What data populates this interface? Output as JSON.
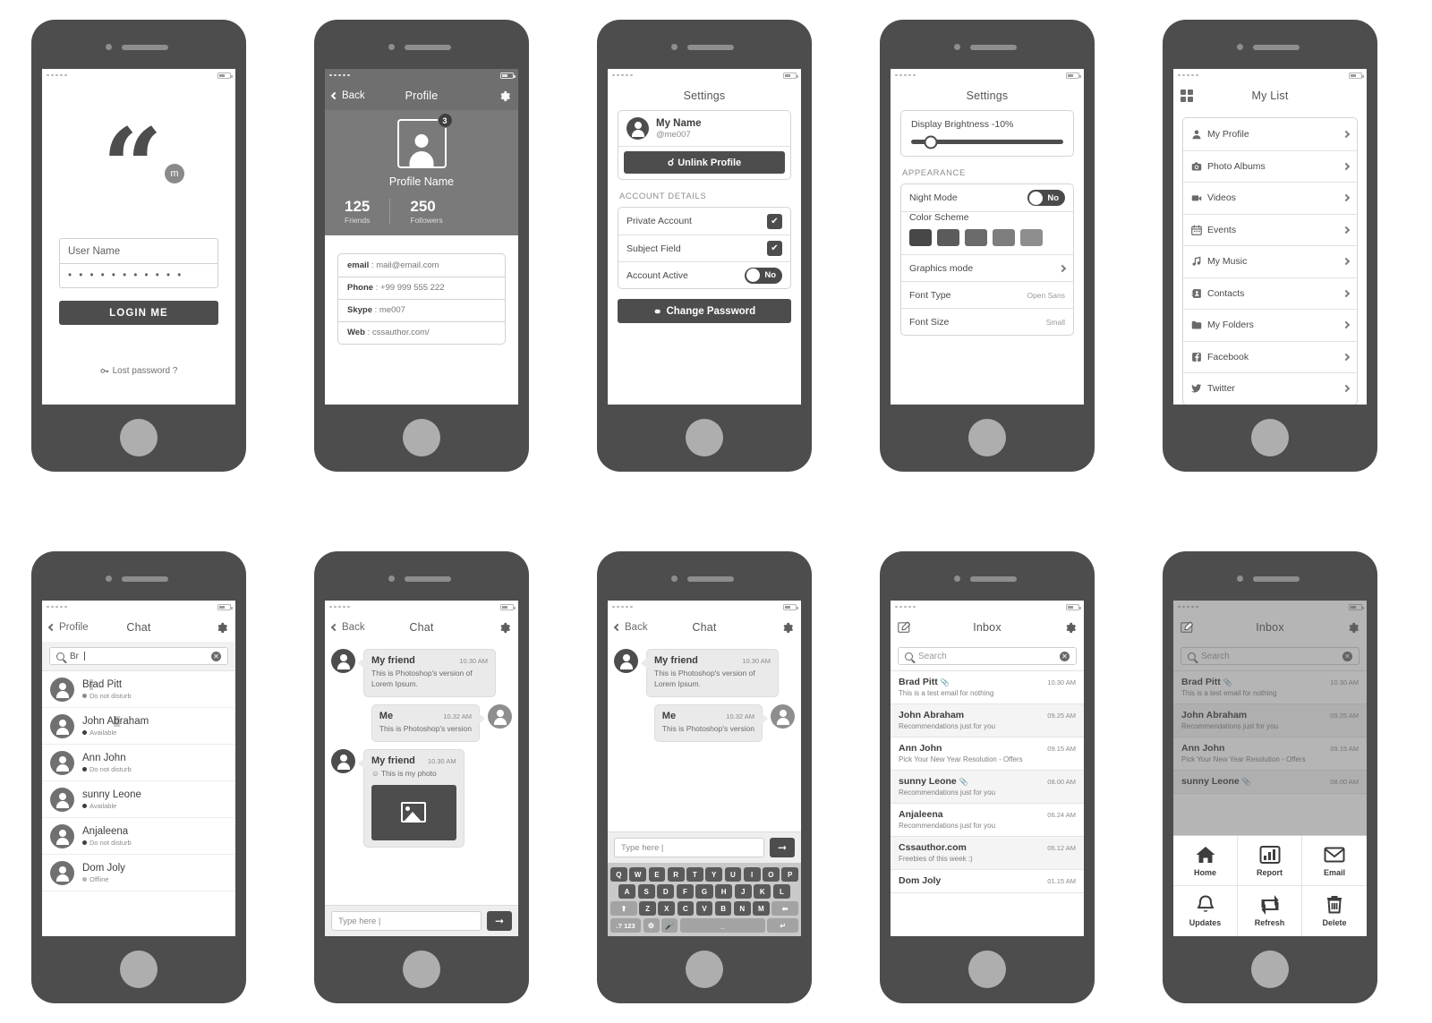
{
  "phone1": {
    "name": "login-screen",
    "logo_badge": "m",
    "username_value": "User Name",
    "password_value": "• • • • • • • • • • •",
    "login_button": "LOGIN ME",
    "lost_password": "Lost password ?"
  },
  "phone2": {
    "name": "profile-screen",
    "nav": {
      "back": "Back",
      "title": "Profile",
      "gear": "gear-icon"
    },
    "avatar_badge": "3",
    "profile_name": "Profile Name",
    "stats": [
      {
        "num": "125",
        "label": "Friends"
      },
      {
        "num": "250",
        "label": "Followers"
      }
    ],
    "info": [
      {
        "key": "email",
        "value": "mail@email.com"
      },
      {
        "key": "Phone",
        "value": "+99 999 555 222"
      },
      {
        "key": "Skype",
        "value": "me007"
      },
      {
        "key": "Web",
        "value": "cssauthor.com/"
      }
    ]
  },
  "phone3": {
    "name": "settings-account-screen",
    "nav_title": "Settings",
    "account": {
      "name": "My Name",
      "handle": "@me007"
    },
    "unlink_button": "Unlink Profile",
    "section_label": "ACCOUNT DETAILS",
    "rows": [
      {
        "label": "Private Account",
        "control": "checkbox",
        "state": "checked"
      },
      {
        "label": "Subject Field",
        "control": "checkbox",
        "state": "checked"
      },
      {
        "label": "Account Active",
        "control": "toggle",
        "state": "No"
      }
    ],
    "change_password_button": "Change Password"
  },
  "phone4": {
    "name": "settings-appearance-screen",
    "nav_title": "Settings",
    "brightness_label": "Display Brightness -10%",
    "brightness_percent": 10,
    "section_label": "APPEARANCE",
    "night_mode": {
      "label": "Night Mode",
      "state": "No"
    },
    "color_scheme": {
      "label": "Color Scheme",
      "swatches": [
        "#474747",
        "#5b5b5b",
        "#6b6b6b",
        "#7d7d7d",
        "#8e8e8e"
      ]
    },
    "rows": [
      {
        "label": "Graphics mode",
        "value": "",
        "arrow": true
      },
      {
        "label": "Font Type",
        "value": "Open Sans",
        "arrow": false
      },
      {
        "label": "Font Size",
        "value": "Small",
        "arrow": false
      }
    ]
  },
  "phone5": {
    "name": "my-list-screen",
    "nav_title": "My List",
    "grid_icon": "grid-icon",
    "items": [
      {
        "label": "My Profile",
        "icon": "person-icon"
      },
      {
        "label": "Photo Albums",
        "icon": "camera-icon"
      },
      {
        "label": "Videos",
        "icon": "video-camera-icon"
      },
      {
        "label": "Events",
        "icon": "calendar-icon"
      },
      {
        "label": "My Music",
        "icon": "music-note-icon"
      },
      {
        "label": "Contacts",
        "icon": "address-book-icon"
      },
      {
        "label": "My Folders",
        "icon": "folder-icon"
      },
      {
        "label": "Facebook",
        "icon": "facebook-icon"
      },
      {
        "label": "Twitter",
        "icon": "twitter-icon"
      }
    ]
  },
  "phone6": {
    "name": "chat-contacts-screen",
    "nav": {
      "back": "Profile",
      "title": "Chat"
    },
    "search_value": "Br",
    "contacts": [
      {
        "name_pre": "B",
        "name_hl": "r",
        "name_post": "ad Pitt",
        "status": "Do not disturb",
        "dot": "#8b8b8b"
      },
      {
        "name_pre": "John A",
        "name_hl": "b",
        "name_post": "raham",
        "status": "Available",
        "dot": "#3d3d3d"
      },
      {
        "name_pre": "Ann John",
        "name_hl": "",
        "name_post": "",
        "status": "Do not disturb",
        "dot": "#3d3d3d"
      },
      {
        "name_pre": "sunny Leone",
        "name_hl": "",
        "name_post": "",
        "status": "Available",
        "dot": "#3d3d3d"
      },
      {
        "name_pre": "Anjaleena",
        "name_hl": "",
        "name_post": "",
        "status": "Do not disturb",
        "dot": "#3d3d3d"
      },
      {
        "name_pre": "Dom Joly",
        "name_hl": "",
        "name_post": "",
        "status": "Offline",
        "dot": "#b5b5b5"
      }
    ]
  },
  "phone7": {
    "name": "chat-thread-screen",
    "nav": {
      "back": "Back",
      "title": "Chat"
    },
    "messages": [
      {
        "side": "them",
        "name": "My friend",
        "time": "10.30 AM",
        "text": "This is Photoshop's version of Lorem Ipsum.",
        "photo": false
      },
      {
        "side": "me",
        "name": "Me",
        "time": "10.32 AM",
        "text": "This is Photoshop's version",
        "photo": false
      },
      {
        "side": "them",
        "name": "My friend",
        "time": "10.30 AM",
        "text": "This is my photo",
        "photo": true
      }
    ],
    "composer_placeholder": "Type here |",
    "send_icon": "arrow-right-icon"
  },
  "phone8": {
    "name": "chat-keyboard-screen",
    "nav": {
      "back": "Back",
      "title": "Chat"
    },
    "messages": [
      {
        "side": "them",
        "name": "My friend",
        "time": "10.30 AM",
        "text": "This is Photoshop's version of Lorem Ipsum."
      },
      {
        "side": "me",
        "name": "Me",
        "time": "10.32 AM",
        "text": "This is Photoshop's version"
      }
    ],
    "composer_placeholder": "Type here |",
    "keyboard": {
      "row1": [
        "Q",
        "W",
        "E",
        "R",
        "T",
        "Y",
        "U",
        "I",
        "O",
        "P"
      ],
      "row2": [
        "A",
        "S",
        "D",
        "F",
        "G",
        "H",
        "J",
        "K",
        "L"
      ],
      "row3_shift": "⬆",
      "row3": [
        "Z",
        "X",
        "C",
        "V",
        "B",
        "N",
        "M"
      ],
      "row3_back": "⬅",
      "row4_num": ".? 123",
      "row4_globe": "globe-icon",
      "row4_mic": "mic-icon",
      "row4_space": "",
      "row4_enter": "↵"
    }
  },
  "phone9": {
    "name": "inbox-screen",
    "nav": {
      "title": "Inbox",
      "compose": "compose-icon",
      "gear": "gear-icon"
    },
    "search_placeholder": "Search",
    "mails": [
      {
        "from": "Brad Pitt",
        "clip": true,
        "time": "10.30 AM",
        "subject": "This is a test email for nothing"
      },
      {
        "from": "John Abraham",
        "clip": false,
        "time": "09.25 AM",
        "subject": "Recommendations just for you"
      },
      {
        "from": "Ann John",
        "clip": false,
        "time": "09.15 AM",
        "subject": "Pick Your New Year Resolution - Offers"
      },
      {
        "from": "sunny Leone",
        "clip": true,
        "time": "08.00 AM",
        "subject": "Recommendations just for you"
      },
      {
        "from": "Anjaleena",
        "clip": false,
        "time": "06.24 AM",
        "subject": "Recommendations just for you"
      },
      {
        "from": "Cssauthor.com",
        "clip": false,
        "time": "06.12 AM",
        "subject": "Freebies of this week :)"
      },
      {
        "from": "Dom Joly",
        "clip": false,
        "time": "01.15 AM",
        "subject": ""
      }
    ]
  },
  "phone10": {
    "name": "inbox-tabbar-screen",
    "nav": {
      "title": "Inbox"
    },
    "search_placeholder": "Search",
    "mails": [
      {
        "from": "Brad Pitt",
        "clip": true,
        "time": "10.30 AM",
        "subject": "This is a test email for nothing"
      },
      {
        "from": "John Abraham",
        "clip": false,
        "time": "09.25 AM",
        "subject": "Recommendations just for you"
      },
      {
        "from": "Ann John",
        "clip": false,
        "time": "09.15 AM",
        "subject": "Pick Your New Year Resolution - Offers"
      },
      {
        "from": "sunny Leone",
        "clip": true,
        "time": "08.00 AM",
        "subject": ""
      }
    ],
    "tabs": [
      {
        "label": "Home",
        "icon": "home-icon"
      },
      {
        "label": "Report",
        "icon": "bar-chart-icon"
      },
      {
        "label": "Email",
        "icon": "envelope-icon"
      },
      {
        "label": "Updates",
        "icon": "bell-icon"
      },
      {
        "label": "Refresh",
        "icon": "refresh-icon"
      },
      {
        "label": "Delete",
        "icon": "trash-icon"
      }
    ]
  },
  "theme": {
    "phone_body": "#4d4d4d",
    "accent_dark": "#4d4d4d",
    "hero_gray": "#7a7a7a",
    "bubble_gray": "#eaeaea"
  }
}
